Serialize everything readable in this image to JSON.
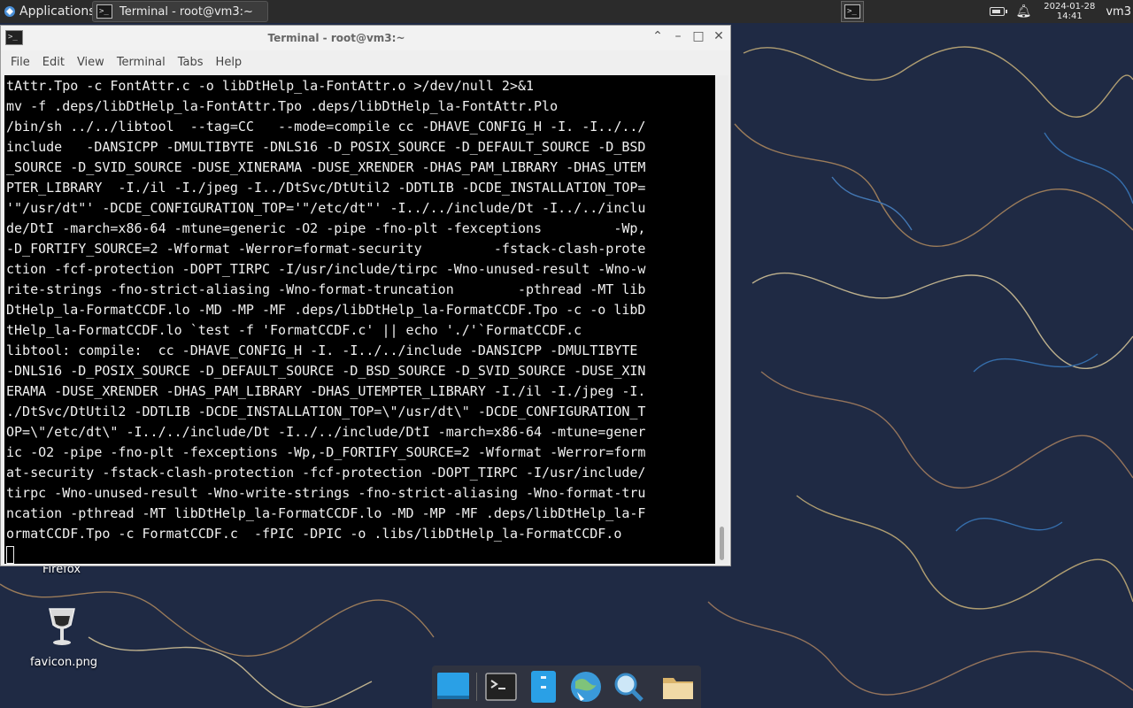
{
  "panel": {
    "applications_label": "Applications",
    "task_title": "Terminal - root@vm3:~",
    "clock_date": "2024-01-28",
    "clock_time": "14:41",
    "user": "vm3"
  },
  "window": {
    "title": "Terminal - root@vm3:~",
    "menu": [
      "File",
      "Edit",
      "View",
      "Terminal",
      "Tabs",
      "Help"
    ],
    "controls": {
      "keep_above": "⌃",
      "minimize": "–",
      "maximize": "□",
      "close": "✕"
    }
  },
  "terminal": {
    "lines": [
      "tAttr.Tpo -c FontAttr.c -o libDtHelp_la-FontAttr.o >/dev/null 2>&1",
      "mv -f .deps/libDtHelp_la-FontAttr.Tpo .deps/libDtHelp_la-FontAttr.Plo",
      "/bin/sh ../../libtool  --tag=CC   --mode=compile cc -DHAVE_CONFIG_H -I. -I../../",
      "include   -DANSICPP -DMULTIBYTE -DNLS16 -D_POSIX_SOURCE -D_DEFAULT_SOURCE -D_BSD",
      "_SOURCE -D_SVID_SOURCE -DUSE_XINERAMA -DUSE_XRENDER -DHAS_PAM_LIBRARY -DHAS_UTEM",
      "PTER_LIBRARY  -I./il -I./jpeg -I../DtSvc/DtUtil2 -DDTLIB -DCDE_INSTALLATION_TOP=",
      "'\"/usr/dt\"' -DCDE_CONFIGURATION_TOP='\"/etc/dt\"' -I../../include/Dt -I../../inclu",
      "de/DtI -march=x86-64 -mtune=generic -O2 -pipe -fno-plt -fexceptions         -Wp,",
      "-D_FORTIFY_SOURCE=2 -Wformat -Werror=format-security         -fstack-clash-prote",
      "ction -fcf-protection -DOPT_TIRPC -I/usr/include/tirpc -Wno-unused-result -Wno-w",
      "rite-strings -fno-strict-aliasing -Wno-format-truncation        -pthread -MT lib",
      "DtHelp_la-FormatCCDF.lo -MD -MP -MF .deps/libDtHelp_la-FormatCCDF.Tpo -c -o libD",
      "tHelp_la-FormatCCDF.lo `test -f 'FormatCCDF.c' || echo './'`FormatCCDF.c",
      "libtool: compile:  cc -DHAVE_CONFIG_H -I. -I../../include -DANSICPP -DMULTIBYTE ",
      "-DNLS16 -D_POSIX_SOURCE -D_DEFAULT_SOURCE -D_BSD_SOURCE -D_SVID_SOURCE -DUSE_XIN",
      "ERAMA -DUSE_XRENDER -DHAS_PAM_LIBRARY -DHAS_UTEMPTER_LIBRARY -I./il -I./jpeg -I.",
      "./DtSvc/DtUtil2 -DDTLIB -DCDE_INSTALLATION_TOP=\\\"/usr/dt\\\" -DCDE_CONFIGURATION_T",
      "OP=\\\"/etc/dt\\\" -I../../include/Dt -I../../include/DtI -march=x86-64 -mtune=gener",
      "ic -O2 -pipe -fno-plt -fexceptions -Wp,-D_FORTIFY_SOURCE=2 -Wformat -Werror=form",
      "at-security -fstack-clash-protection -fcf-protection -DOPT_TIRPC -I/usr/include/",
      "tirpc -Wno-unused-result -Wno-write-strings -fno-strict-aliasing -Wno-format-tru",
      "ncation -pthread -MT libDtHelp_la-FormatCCDF.lo -MD -MP -MF .deps/libDtHelp_la-F",
      "ormatCCDF.Tpo -c FormatCCDF.c  -fPIC -DPIC -o .libs/libDtHelp_la-FormatCCDF.o"
    ]
  },
  "desktop": {
    "icons": [
      {
        "label": "Firefox",
        "icon": "firefox-icon"
      },
      {
        "label": "favicon.png",
        "icon": "favicon-image-icon"
      }
    ]
  },
  "dock": {
    "items": [
      "show-desktop-icon",
      "terminal-icon",
      "file-manager-icon",
      "web-browser-icon",
      "app-finder-icon",
      "folder-icon"
    ]
  },
  "colors": {
    "panel_bg": "#2b2b2b",
    "terminal_bg": "#000000",
    "terminal_fg": "#f0f0f0",
    "wallpaper_bg": "#1d2740",
    "dock_accent": "#2aa0e6"
  }
}
